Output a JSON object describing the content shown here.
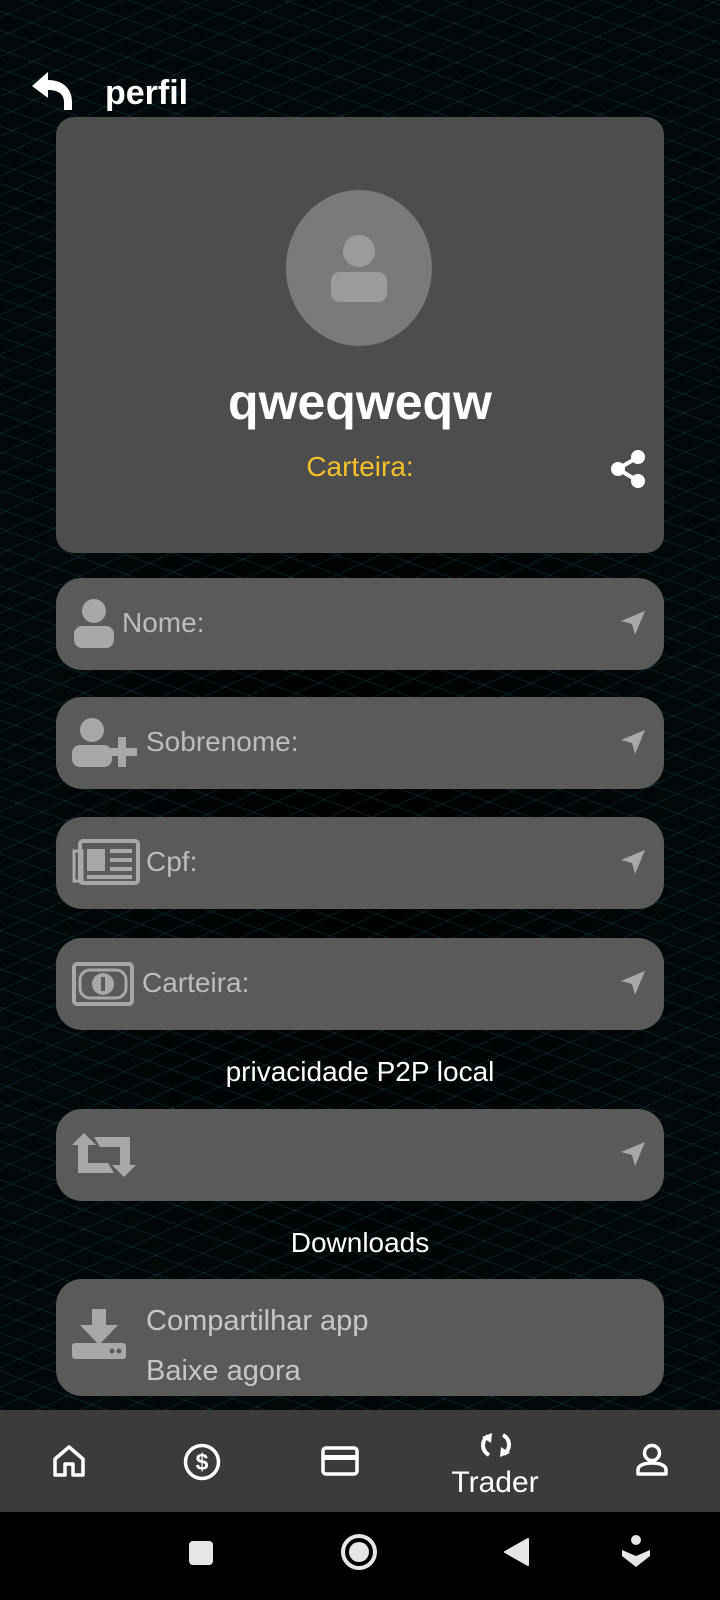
{
  "header": {
    "title": "perfil",
    "back_icon": "back-arrow-icon"
  },
  "profile": {
    "username": "qweqweqw",
    "wallet_label": "Carteira:",
    "accent_color": "#f5c02a"
  },
  "fields": [
    {
      "label": "Nome:",
      "icon": "user-icon"
    },
    {
      "label": "Sobrenome:",
      "icon": "user-plus-icon"
    },
    {
      "label": "Cpf:",
      "icon": "newspaper-icon"
    },
    {
      "label": "Carteira:",
      "icon": "money-bill-icon"
    }
  ],
  "privacy": {
    "title": "privacidade P2P local",
    "icon": "retweet-icon"
  },
  "downloads": {
    "title": "Downloads",
    "card_title": "Compartilhar app",
    "card_subtitle": "Baixe agora"
  },
  "bottom_nav": {
    "items": [
      {
        "name": "home",
        "icon": "home-icon"
      },
      {
        "name": "dollar",
        "icon": "dollar-icon"
      },
      {
        "name": "card",
        "icon": "credit-card-icon"
      },
      {
        "name": "trader",
        "icon": "sync-icon",
        "label": "Trader"
      },
      {
        "name": "profile",
        "icon": "person-icon"
      }
    ]
  }
}
